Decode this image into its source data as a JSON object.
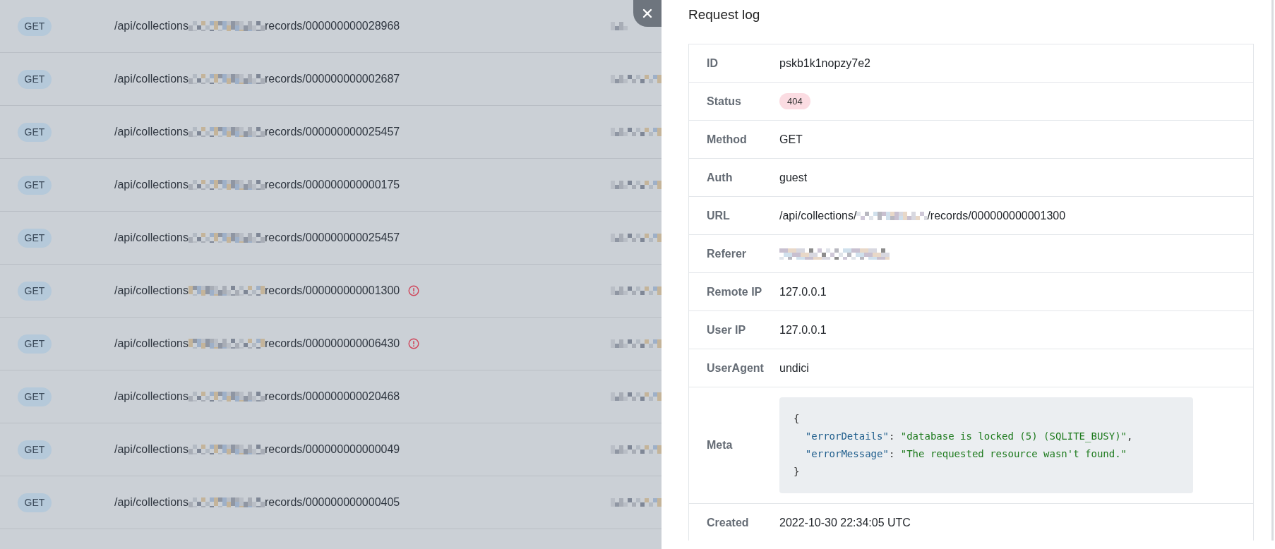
{
  "requests": [
    {
      "method": "GET",
      "path_start": "/api/collections",
      "path_end": "records/000000000028968",
      "error": false
    },
    {
      "method": "GET",
      "path_start": "/api/collections",
      "path_end": "records/000000000002687",
      "error": false
    },
    {
      "method": "GET",
      "path_start": "/api/collections",
      "path_end": "records/000000000025457",
      "error": false
    },
    {
      "method": "GET",
      "path_start": "/api/collections",
      "path_end": "records/000000000000175",
      "error": false
    },
    {
      "method": "GET",
      "path_start": "/api/collections",
      "path_end": "records/000000000025457",
      "error": false
    },
    {
      "method": "GET",
      "path_start": "/api/collections",
      "path_end": "records/000000000001300",
      "error": true
    },
    {
      "method": "GET",
      "path_start": "/api/collections",
      "path_end": "records/000000000006430",
      "error": true
    },
    {
      "method": "GET",
      "path_start": "/api/collections",
      "path_end": "records/000000000020468",
      "error": false
    },
    {
      "method": "GET",
      "path_start": "/api/collections",
      "path_end": "records/000000000000049",
      "error": false
    },
    {
      "method": "GET",
      "path_start": "/api/collections",
      "path_end": "records/000000000000405",
      "error": false
    }
  ],
  "panel": {
    "title": "Request log",
    "fields": [
      {
        "label": "ID",
        "kind": "text",
        "value": "pskb1k1nopzy7e2"
      },
      {
        "label": "Status",
        "kind": "status",
        "value": "404"
      },
      {
        "label": "Method",
        "kind": "text",
        "value": "GET"
      },
      {
        "label": "Auth",
        "kind": "text",
        "value": "guest"
      },
      {
        "label": "URL",
        "kind": "url",
        "value_start": "/api/collections/",
        "value_end": "/records/000000000001300"
      },
      {
        "label": "Referer",
        "kind": "redacted"
      },
      {
        "label": "Remote IP",
        "kind": "text",
        "value": "127.0.0.1"
      },
      {
        "label": "User IP",
        "kind": "text",
        "value": "127.0.0.1"
      },
      {
        "label": "UserAgent",
        "kind": "text",
        "value": "undici"
      },
      {
        "label": "Meta",
        "kind": "code",
        "open": "{",
        "close": "}",
        "lines": [
          {
            "key": "\"errorDetails\"",
            "sep": ": ",
            "value": "\"database is locked (5) (SQLITE_BUSY)\"",
            "trail": ","
          },
          {
            "key": "\"errorMessage\"",
            "sep": ": ",
            "value": "\"The requested resource wasn't found.\""
          }
        ]
      },
      {
        "label": "Created",
        "kind": "text",
        "value": "2022-10-30 22:34:05 UTC"
      }
    ]
  }
}
